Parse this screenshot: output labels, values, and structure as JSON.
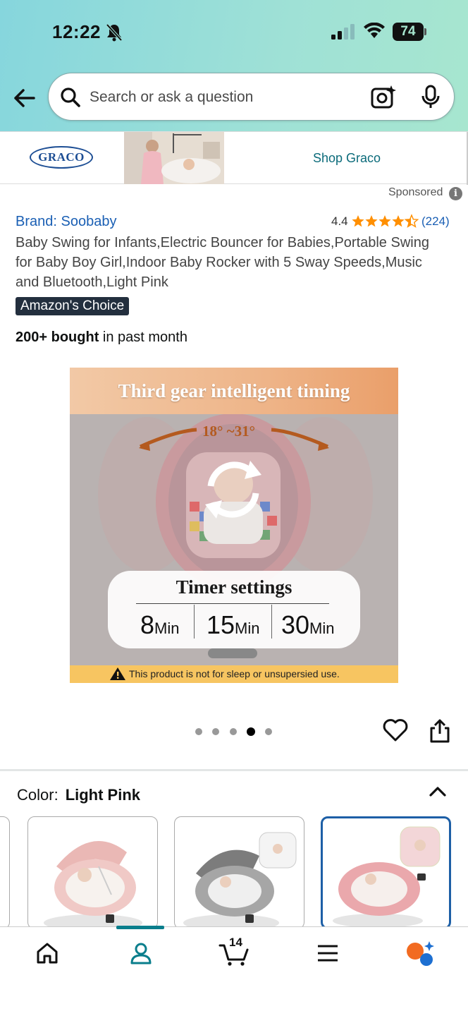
{
  "status_bar": {
    "time": "12:22",
    "battery": "74"
  },
  "header": {
    "search_placeholder": "Search or ask a question"
  },
  "sponsored_banner": {
    "brand_logo": "GRACO",
    "cta": "Shop Graco",
    "sponsored_label": "Sponsored"
  },
  "product": {
    "brand": "Brand: Soobaby",
    "rating": "4.4",
    "stars": 4.4,
    "rating_count": "(224)",
    "title": "Baby Swing for Infants,Electric Bouncer for Babies,Portable Swing for Baby Boy Girl,Indoor Baby Rocker with 5 Sway Speeds,Music and Bluetooth,Light Pink",
    "badge": "Amazon's Choice",
    "bought_bold": "200+ bought",
    "bought_rest": " in past month"
  },
  "image": {
    "header_text": "Third gear intelligent timing",
    "angle_text": "18°  ~31°",
    "timer_title": "Timer settings",
    "timer_options": [
      {
        "value": "8",
        "unit": "Min"
      },
      {
        "value": "15",
        "unit": "Min"
      },
      {
        "value": "30",
        "unit": "Min"
      }
    ],
    "warning": "This product is not for sleep or unsupersied use.",
    "carousel_count": 5,
    "carousel_active": 4
  },
  "color": {
    "label": "Color:",
    "selected": "Light Pink"
  },
  "bottom_nav": {
    "cart_count": "14"
  },
  "colors": {
    "link_blue": "#1a5fb4",
    "teal": "#0a7e8c",
    "badge_bg": "#232f3e",
    "star_orange": "#ff8f00",
    "selected_border": "#1d5fa6"
  }
}
